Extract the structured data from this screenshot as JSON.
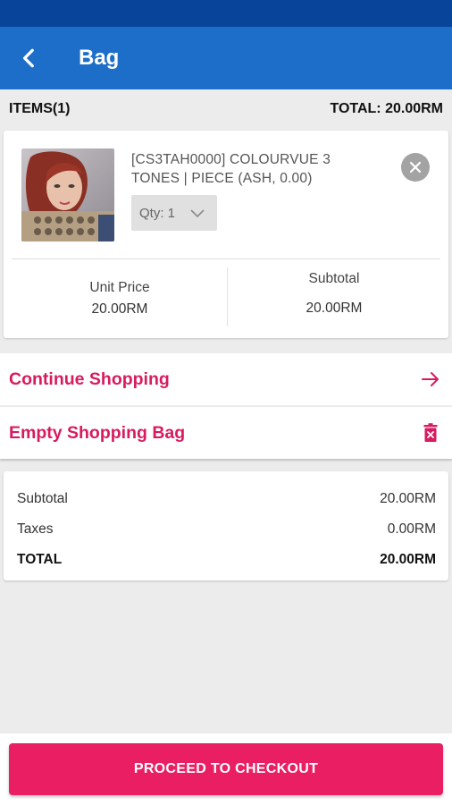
{
  "app_bar": {
    "title": "Bag",
    "back_icon": "chevron-left-icon"
  },
  "summary": {
    "items_label": "ITEMS(1)",
    "total_label": "TOTAL: 20.00RM"
  },
  "cart_item": {
    "name": "[CS3TAH0000] COLOURVUE 3 TONES | PIECE (ASH, 0.00)",
    "qty_label": "Qty: 1",
    "unit_price_label": "Unit Price",
    "unit_price_value": "20.00RM",
    "subtotal_label": "Subtotal",
    "subtotal_value": "20.00RM",
    "remove_icon": "close-icon",
    "qty_icon": "chevron-down-icon"
  },
  "actions": {
    "continue_label": "Continue Shopping",
    "continue_icon": "arrow-right-icon",
    "empty_label": "Empty Shopping Bag",
    "empty_icon": "trash-icon"
  },
  "totals": {
    "subtotal_label": "Subtotal",
    "subtotal_value": "20.00RM",
    "taxes_label": "Taxes",
    "taxes_value": "0.00RM",
    "total_label": "TOTAL",
    "total_value": "20.00RM"
  },
  "checkout": {
    "label": "PROCEED TO CHECKOUT"
  },
  "colors": {
    "status_bar": "#08449a",
    "app_bar": "#1d6ec9",
    "accent": "#d81b60",
    "checkout_button": "#e91e63"
  }
}
